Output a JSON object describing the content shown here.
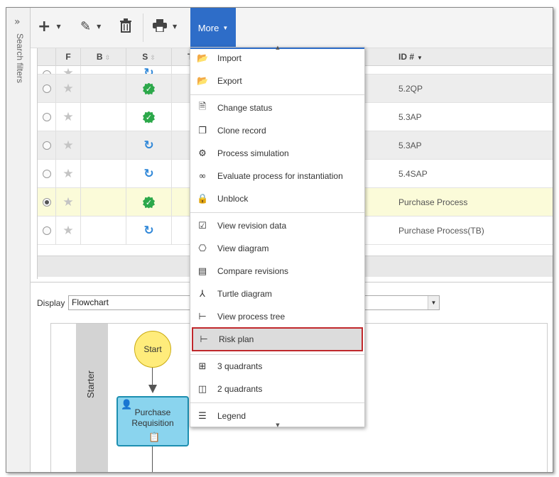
{
  "rail": {
    "chevron": "»",
    "label": "Search filters"
  },
  "toolbar": {
    "add_icon": "+",
    "edit_icon": "✎",
    "delete_icon": "🗑",
    "print_icon": "⎙",
    "more_label": "More"
  },
  "grid": {
    "columns": [
      {
        "label": "F"
      },
      {
        "label": "B"
      },
      {
        "label": "S"
      },
      {
        "label": "T"
      },
      {
        "label": "ID #"
      }
    ],
    "rows": [
      {
        "status": "ok",
        "id": "5.2QP",
        "selected": false
      },
      {
        "status": "ok",
        "id": "5.3AP",
        "selected": false
      },
      {
        "status": "sync",
        "id": "5.3AP",
        "selected": false
      },
      {
        "status": "sync",
        "id": "5.4SAP",
        "selected": false
      },
      {
        "status": "ok",
        "id": "Purchase Process",
        "selected": true
      },
      {
        "status": "sync",
        "id": "Purchase Process(TB)",
        "selected": false
      }
    ]
  },
  "display": {
    "label": "Display",
    "value": "Flowchart"
  },
  "diagram": {
    "lane": "Starter",
    "start": "Start",
    "task_line1": "Purchase",
    "task_line2": "Requisition"
  },
  "menu": {
    "items": [
      {
        "label": "Import",
        "icon": "folder-import-icon"
      },
      {
        "label": "Export",
        "icon": "folder-export-icon"
      },
      {
        "label": "Change status",
        "icon": "document-status-icon"
      },
      {
        "label": "Clone record",
        "icon": "clone-icon"
      },
      {
        "label": "Process simulation",
        "icon": "simulation-icon"
      },
      {
        "label": "Evaluate process for instantiation",
        "icon": "glasses-icon"
      },
      {
        "label": "Unblock",
        "icon": "lock-icon"
      },
      {
        "label": "View revision data",
        "icon": "revision-icon"
      },
      {
        "label": "View diagram",
        "icon": "diagram-icon"
      },
      {
        "label": "Compare revisions",
        "icon": "compare-icon"
      },
      {
        "label": "Turtle diagram",
        "icon": "turtle-icon"
      },
      {
        "label": "View process tree",
        "icon": "tree-icon"
      },
      {
        "label": "Risk plan",
        "icon": "risk-tree-icon"
      },
      {
        "label": "3 quadrants",
        "icon": "three-quadrants-icon"
      },
      {
        "label": "2 quadrants",
        "icon": "two-quadrants-icon"
      },
      {
        "label": "Legend",
        "icon": "legend-icon"
      }
    ],
    "highlight_color": "#c0282c"
  }
}
